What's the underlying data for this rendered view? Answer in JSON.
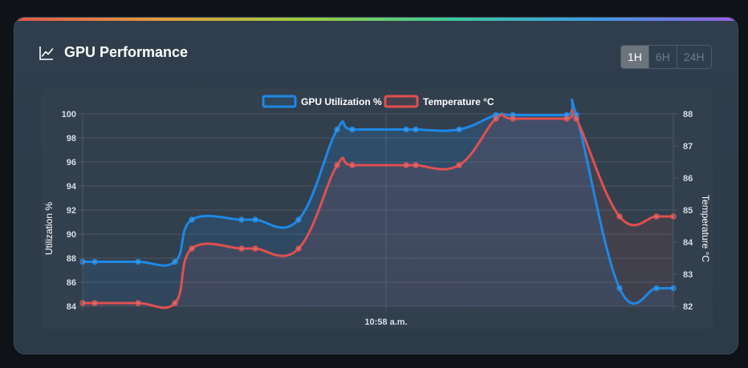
{
  "card": {
    "title": "GPU Performance",
    "title_icon": "line-chart-icon",
    "ranges": [
      {
        "label": "1H",
        "active": true
      },
      {
        "label": "6H",
        "active": false
      },
      {
        "label": "24H",
        "active": false
      }
    ]
  },
  "colors": {
    "utilization": "#1e88e5",
    "temperature": "#e05050",
    "text": "#ffffff",
    "tick": "#d7dde3"
  },
  "chart_data": {
    "type": "line",
    "title": "",
    "xlabel": "",
    "x_tick_labels": [
      "10:58 a.m."
    ],
    "legend_position": "top-center",
    "grid": true,
    "series": [
      {
        "name": "GPU Utilization %",
        "axis": "left",
        "values": [
          87.7,
          87.7,
          87.7,
          87.7,
          91.2,
          91.2,
          91.2,
          91.2,
          98.7,
          98.7,
          98.7,
          98.7,
          98.7,
          99.9,
          99.9,
          99.9,
          99.9,
          85.5,
          85.5,
          85.5
        ]
      },
      {
        "name": "Temperature °C",
        "axis": "right",
        "values": [
          82.1,
          82.1,
          82.1,
          82.1,
          83.8,
          83.8,
          83.8,
          83.8,
          86.4,
          86.4,
          86.4,
          86.4,
          86.4,
          87.85,
          87.85,
          87.85,
          87.85,
          84.8,
          84.8,
          84.8
        ]
      }
    ],
    "y_left": {
      "label": "Utilization %",
      "ylim": [
        84,
        100
      ],
      "ticks": [
        84,
        86,
        88,
        90,
        92,
        94,
        96,
        98,
        100
      ]
    },
    "y_right": {
      "label": "Temperature °C",
      "ylim": [
        82,
        88
      ],
      "ticks": [
        82,
        83,
        84,
        85,
        86,
        87,
        88
      ]
    }
  }
}
